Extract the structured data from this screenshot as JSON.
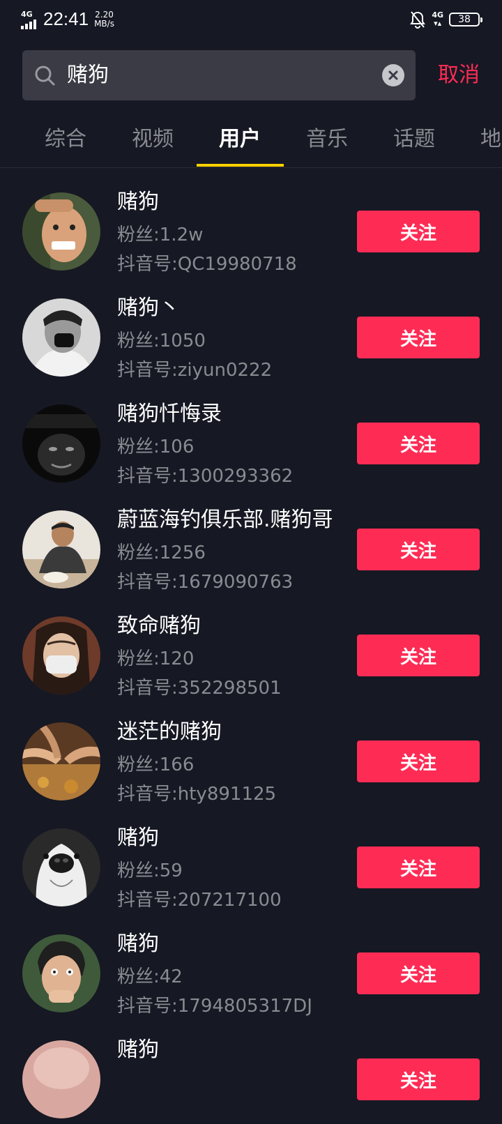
{
  "status_bar": {
    "network_left": "4G",
    "time": "22:41",
    "speed_value": "2.20",
    "speed_unit": "MB/s",
    "network_right": "4G",
    "battery": "38",
    "icons": [
      "signal-icon",
      "bell-off-icon",
      "battery-icon"
    ]
  },
  "search": {
    "query": "赌狗",
    "cancel_label": "取消",
    "icons": [
      "search-icon",
      "clear-icon"
    ]
  },
  "tabs": [
    {
      "label": "综合"
    },
    {
      "label": "视频"
    },
    {
      "label": "用户",
      "active": true
    },
    {
      "label": "音乐"
    },
    {
      "label": "话题"
    },
    {
      "label": "地"
    }
  ],
  "colors": {
    "background": "#161823",
    "accent": "#fe2c55",
    "tab_indicator": "#fdd100",
    "secondary_text": "#8a8b91"
  },
  "follow_label": "关注",
  "users": [
    {
      "name": "赌狗",
      "fans": "粉丝:1.2w",
      "id": "抖音号:QC19980718",
      "avatar": "avatar-man-grimace"
    },
    {
      "name": "赌狗丶",
      "fans": "粉丝:1050",
      "id": "抖音号:ziyun0222",
      "avatar": "avatar-masked-man"
    },
    {
      "name": "赌狗忏悔录",
      "fans": "粉丝:106",
      "id": "抖音号:1300293362",
      "avatar": "avatar-dark-face"
    },
    {
      "name": "蔚蓝海钓俱乐部.赌狗哥",
      "fans": "粉丝:1256",
      "id": "抖音号:1679090763",
      "avatar": "avatar-man-table"
    },
    {
      "name": "致命赌狗",
      "fans": "粉丝:120",
      "id": "抖音号:352298501",
      "avatar": "avatar-masked-woman"
    },
    {
      "name": "迷茫的赌狗",
      "fans": "粉丝:166",
      "id": "抖音号:hty891125",
      "avatar": "avatar-hands-food"
    },
    {
      "name": "赌狗",
      "fans": "粉丝:59",
      "id": "抖音号:207217100",
      "avatar": "avatar-dog"
    },
    {
      "name": "赌狗",
      "fans": "粉丝:42",
      "id": "抖音号:1794805317DJ",
      "avatar": "avatar-nervous-man"
    },
    {
      "name": "赌狗",
      "fans": "",
      "id": "",
      "avatar": "avatar-partial"
    }
  ]
}
